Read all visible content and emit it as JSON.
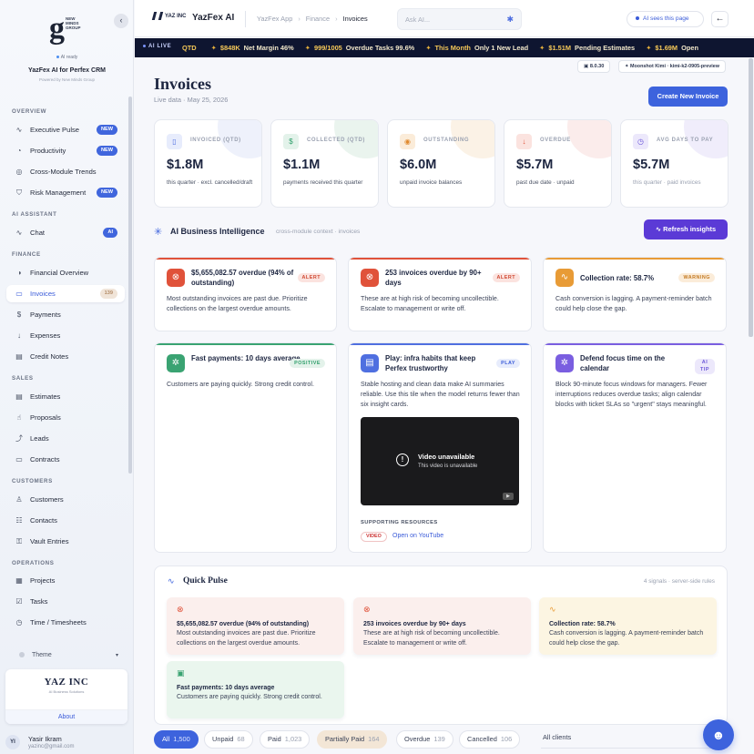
{
  "sidebar": {
    "logo_letter": "g",
    "logo_text": "NEW MINDS GROUP",
    "ai_ready": "AI ready",
    "title": "YazFex AI for Perfex CRM",
    "subtitle": "Powered by New Minds Group",
    "collapse_icon": "‹",
    "sections": {
      "overview": "OVERVIEW",
      "assistant": "AI ASSISTANT",
      "finance": "FINANCE",
      "sales": "SALES",
      "customers": "CUSTOMERS",
      "operations": "OPERATIONS"
    },
    "items": [
      {
        "label": "Executive Pulse",
        "icon": "activity-icon",
        "badge": "NEW"
      },
      {
        "label": "Productivity",
        "icon": "gauge-icon",
        "badge": "NEW"
      },
      {
        "label": "Cross-Module Trends",
        "icon": "trend-icon"
      },
      {
        "label": "Risk Management",
        "icon": "shield-icon",
        "badge": "NEW"
      },
      {
        "label": "Chat",
        "icon": "activity-icon",
        "badge": "AI"
      },
      {
        "label": "Financial Overview",
        "icon": "pie-icon"
      },
      {
        "label": "Invoices",
        "icon": "invoice-icon",
        "badge": "139"
      },
      {
        "label": "Payments",
        "icon": "dollar-icon"
      },
      {
        "label": "Expenses",
        "icon": "arrow-down-icon"
      },
      {
        "label": "Credit Notes",
        "icon": "note-icon"
      },
      {
        "label": "Estimates",
        "icon": "doc-icon"
      },
      {
        "label": "Proposals",
        "icon": "thumb-icon"
      },
      {
        "label": "Leads",
        "icon": "lead-icon"
      },
      {
        "label": "Contracts",
        "icon": "contract-icon"
      },
      {
        "label": "Customers",
        "icon": "user-icon"
      },
      {
        "label": "Contacts",
        "icon": "contacts-icon"
      },
      {
        "label": "Vault Entries",
        "icon": "vault-icon"
      },
      {
        "label": "Projects",
        "icon": "folder-icon"
      },
      {
        "label": "Tasks",
        "icon": "tasks-icon"
      },
      {
        "label": "Time / Timesheets",
        "icon": "clock-icon"
      }
    ],
    "theme_label": "Theme",
    "brand_name": "YAZ INC",
    "brand_sub": "AI Business Solutions",
    "about": "About",
    "user": {
      "initials": "YI",
      "name": "Yasir Ikram",
      "email": "yazinc@gmail.com"
    }
  },
  "topbar": {
    "logo": "YAZ INC",
    "app_name": "YazFex AI",
    "breadcrumbs": [
      "YazFex App",
      "Finance",
      "Invoices"
    ],
    "search_placeholder": "Ask AI...",
    "ai_sees": "AI sees this page",
    "back_icon": "←"
  },
  "ticker": {
    "live": "AI LIVE",
    "items": [
      {
        "value": "QTD",
        "label": ""
      },
      {
        "value": "$848K",
        "label": "Net Margin 46%"
      },
      {
        "value": "999/1005",
        "label": "Overdue Tasks 99.6%"
      },
      {
        "value": "This Month",
        "label": "Only 1 New Lead"
      },
      {
        "value": "$1.51M",
        "label": "Pending Estimates"
      },
      {
        "value": "$1.69M",
        "label": "Open"
      }
    ],
    "version": "8.0.30",
    "model": "Moonshot Kimi · kimi-k2-0905-preview"
  },
  "page": {
    "title": "Invoices",
    "subtitle": "Live data · May 25, 2026",
    "create_button": "Create New Invoice"
  },
  "kpis": [
    {
      "label": "INVOICED (QTD)",
      "value": "$1.8M",
      "note": "this quarter · excl. cancelled/draft",
      "color": "#4f6fe0",
      "icon": "invoice-icon"
    },
    {
      "label": "COLLECTED (QTD)",
      "value": "$1.1M",
      "note": "payments received this quarter",
      "color": "#2e9e6a",
      "icon": "dollar-icon"
    },
    {
      "label": "OUTSTANDING",
      "value": "$6.0M",
      "note": "unpaid invoice balances",
      "color": "#e08a2e",
      "icon": "coin-icon"
    },
    {
      "label": "OVERDUE",
      "value": "$5.7M",
      "note": "past due date · unpaid",
      "color": "#e0523a",
      "icon": "arrow-down-icon"
    },
    {
      "label": "AVG DAYS TO PAY",
      "value": "$5.7M",
      "note": "this quarter · paid invoices",
      "color": "#6b57d9",
      "icon": "clock-icon"
    }
  ],
  "bi": {
    "title": "AI Business Intelligence",
    "subtitle": "cross-module context · invoices",
    "refresh": "Refresh insights"
  },
  "insights": [
    {
      "title": "$5,655,082.57 overdue (94% of outstanding)",
      "tag": "ALERT",
      "body": "Most outstanding invoices are past due. Prioritize collections on the largest overdue amounts.",
      "icon": "x-circle-icon"
    },
    {
      "title": "253 invoices overdue by 90+ days",
      "tag": "ALERT",
      "body": "These are at high risk of becoming uncollectible. Escalate to management or write off.",
      "icon": "x-circle-icon"
    },
    {
      "title": "Collection rate: 58.7%",
      "tag": "WARNING",
      "body": "Cash conversion is lagging. A payment-reminder batch could help close the gap.",
      "icon": "pulse-icon"
    },
    {
      "title": "Fast payments: 10 days average",
      "tag": "POSITIVE",
      "body": "Customers are paying quickly. Strong credit control.",
      "icon": "sparkle-icon"
    },
    {
      "title": "Play: infra habits that keep Perfex trustworthy",
      "tag": "PLAY",
      "body": "Stable hosting and clean data make AI summaries reliable. Use this tile when the model returns fewer than six insight cards.",
      "icon": "server-icon",
      "video_title": "Video unavailable",
      "video_sub": "This video is unavailable",
      "resources": "SUPPORTING RESOURCES",
      "video_tag": "VIDEO",
      "link": "Open on YouTube"
    },
    {
      "title": "Defend focus time on the calendar",
      "tag": "AI TIP",
      "body": "Block 90-minute focus windows for managers. Fewer interruptions reduces overdue tasks; align calendar blocks with ticket SLAs so \"urgent\" stays meaningful.",
      "icon": "sparkle-icon"
    }
  ],
  "pulse": {
    "title": "Quick Pulse",
    "meta": "4 signals · server-side rules",
    "cards": [
      {
        "title": "$5,655,082.57 overdue (94% of outstanding)",
        "body": "Most outstanding invoices are past due. Prioritize collections on the largest overdue amounts.",
        "icon": "x-circle-icon"
      },
      {
        "title": "253 invoices overdue by 90+ days",
        "body": "These are at high risk of becoming uncollectible. Escalate to management or write off.",
        "icon": "x-circle-icon"
      },
      {
        "title": "Collection rate: 58.7%",
        "body": "Cash conversion is lagging. A payment-reminder batch could help close the gap.",
        "icon": "pulse-icon"
      },
      {
        "title": "Fast payments: 10 days average",
        "body": "Customers are paying quickly. Strong credit control.",
        "icon": "wallet-icon"
      }
    ]
  },
  "filters": [
    {
      "label": "All",
      "count": "1,500"
    },
    {
      "label": "Unpaid",
      "count": "68"
    },
    {
      "label": "Paid",
      "count": "1,023"
    },
    {
      "label": "Partially Paid",
      "count": "164"
    },
    {
      "label": "Overdue",
      "count": "139"
    },
    {
      "label": "Cancelled",
      "count": "106"
    }
  ],
  "clients_select": "All clients"
}
